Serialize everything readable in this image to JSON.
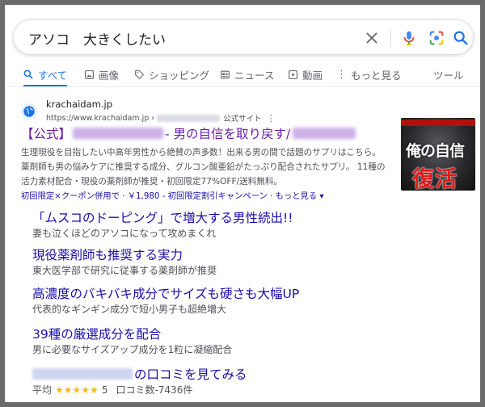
{
  "search": {
    "query": "アソコ　大きくしたい"
  },
  "tabs": [
    {
      "label": "すべて",
      "icon": "search-icon",
      "active": true
    },
    {
      "label": "画像",
      "icon": "image-icon"
    },
    {
      "label": "ショッピング",
      "icon": "tag-icon"
    },
    {
      "label": "ニュース",
      "icon": "news-icon"
    },
    {
      "label": "動画",
      "icon": "play-icon"
    },
    {
      "label": "もっと見る",
      "icon": "more-vert-icon"
    },
    {
      "label": "ツール"
    }
  ],
  "result": {
    "site_name": "krachaidam.jp",
    "url": "https://www.krachaidam.jp",
    "url_sep": "›",
    "official_label": "公式サイト",
    "title_prefix": "【公式】",
    "title_mid": "- 男の自信を取り戻す/",
    "snippet_lines": [
      "生理現役を目指したい中高年男性から絶賛の声多数！出来る男の間で話題のサプリはこちら。",
      "薬剤師も男の悩みケアに推奨する成分、グルコン酸亜鉛がたっぷり配合されたサプリ。 11種の",
      "活力素材配合・現役の薬剤師が推奨・初回限定77%OFF/送料無料。"
    ],
    "offer": "初回限定×クーポン併用で · ￥1,980 - 初回限定割引キャンペーン · もっと見る ▾",
    "thumbnail_text_1": "俺の自信",
    "thumbnail_text_2": "復活"
  },
  "sitelinks": [
    {
      "title": "「ムスコのドーピング」で増大する男性続出!!",
      "desc": "妻も泣くほどのアソコになって攻めまくれ"
    },
    {
      "title": "現役薬剤師も推奨する実力",
      "desc": "東大医学部で研究に従事する薬剤師が推奨"
    },
    {
      "title": "高濃度のバキバキ成分でサイズも硬さも大幅UP",
      "desc": "代表的なギンギン成分で短小男子も超絶増大"
    },
    {
      "title": "39種の厳選成分を配合",
      "desc": "男に必要なサイズアップ成分を1粒に凝縮配合"
    },
    {
      "title": "の口コミを見てみる"
    }
  ],
  "rating": {
    "prefix": "平均",
    "stars": "★★★★★",
    "value": "5",
    "count": "口コミ数-7436件"
  },
  "colors": {
    "link": "#1a0dab",
    "visited": "#681da8",
    "accent": "#1a73e8",
    "star": "#fbbc04"
  }
}
